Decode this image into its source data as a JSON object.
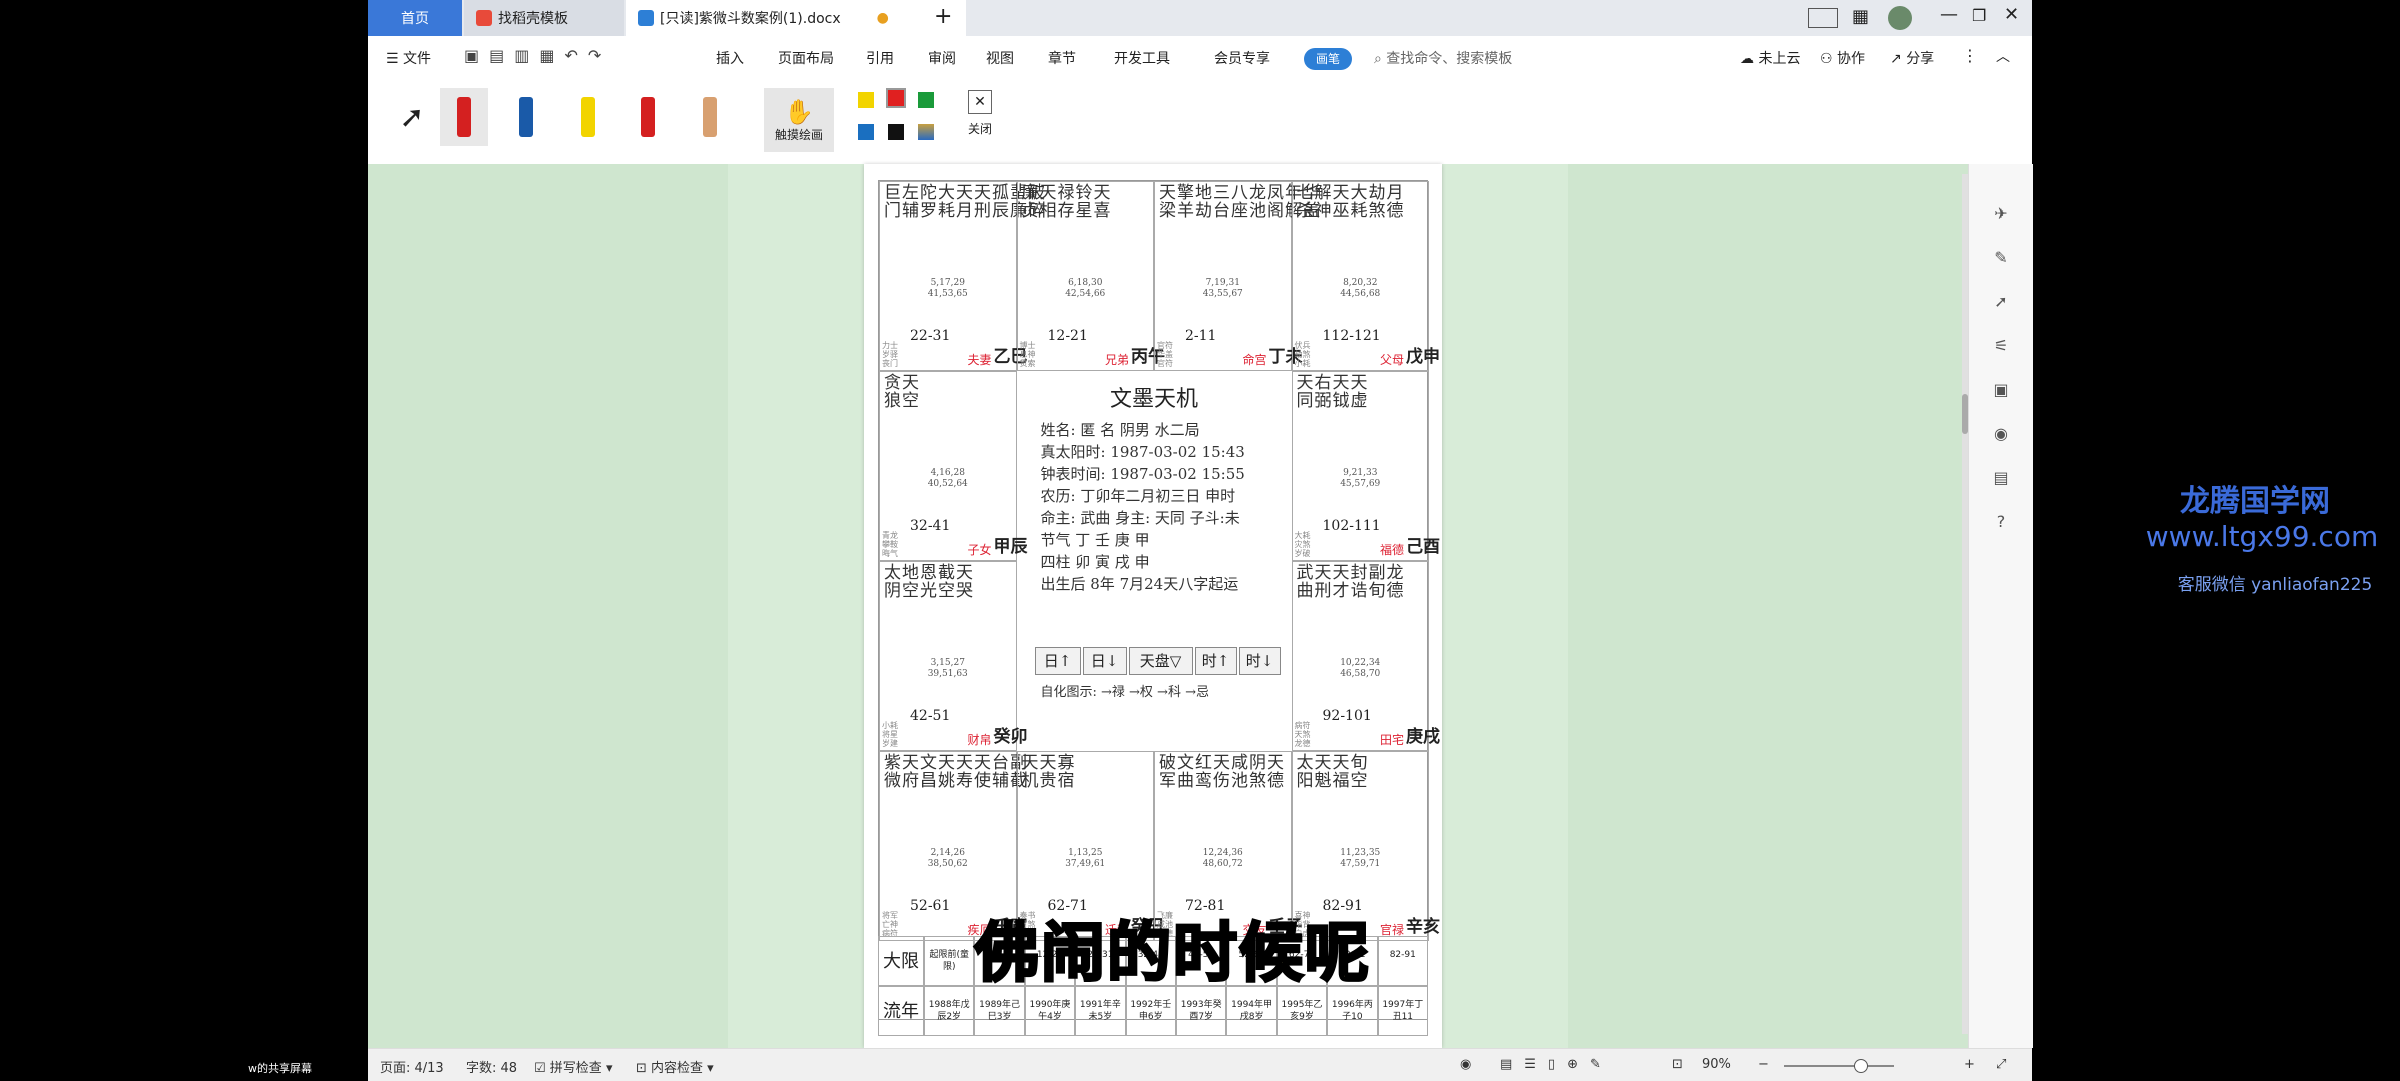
{
  "tabs": {
    "home": "首页",
    "template": "找稻壳模板",
    "doc": "[只读]紫微斗数案例(1).docx"
  },
  "menu": {
    "file": "文件",
    "items": [
      "插入",
      "页面布局",
      "引用",
      "审阅",
      "视图",
      "章节",
      "开发工具",
      "会员专享"
    ],
    "mode": "画笔",
    "search": "查找命令、搜索模板",
    "cloud": "未上云",
    "collab": "协作",
    "share": "分享"
  },
  "toolbar": {
    "touch_draw": "触摸绘画",
    "close": "关闭",
    "swatches": [
      "#f2d400",
      "#e02020",
      "#1a9a3a",
      "#1a6fc0",
      "#111111",
      "#c8a040"
    ]
  },
  "cells": [
    {
      "stars": "巨左陀大天天孤蜚破\n门辅罗耗月刑辰廉碎",
      "cyc": "5,17,29\n41,53,65",
      "rng": "22-31",
      "gz": "乙巳",
      "pal": "夫妻",
      "small": "力士\n岁驿\n丧门"
    },
    {
      "stars": "廉天禄铃天\n贞相存星喜",
      "cyc": "6,18,30\n42,54,66",
      "rng": "12-21",
      "gz": "丙午",
      "pal": "兄弟",
      "small": "博士\n息神\n贯索"
    },
    {
      "stars": "天擎地三八龙凤年华\n梁羊劫台座池阁解盖",
      "cyc": "7,19,31\n43,55,67",
      "rng": "2-11",
      "gz": "丁未",
      "pal": "命宫",
      "small": "官符\n华盖\n官符"
    },
    {
      "stars": "七解天大劫月\n杀神巫耗煞德",
      "cyc": "8,20,32\n44,56,68",
      "rng": "112-121",
      "gz": "戊申",
      "pal": "父母",
      "small": "伏兵\n劫煞\n小耗"
    },
    {
      "stars": "贪天\n狼空",
      "cyc": "4,16,28\n40,52,64",
      "rng": "32-41",
      "gz": "甲辰",
      "pal": "子女",
      "small": "青龙\n攀鞍\n晦气"
    },
    {
      "stars": "天右天天\n同弼钺虚",
      "cyc": "9,21,33\n45,57,69",
      "rng": "102-111",
      "gz": "己酉",
      "pal": "福德",
      "small": "大耗\n灾煞\n岁破"
    },
    {
      "stars": "太地恩截天\n阴空光空哭",
      "cyc": "3,15,27\n39,51,63",
      "rng": "42-51",
      "gz": "癸卯",
      "pal": "财帛",
      "small": "小耗\n将星\n岁建"
    },
    {
      "stars": "武天天封副龙\n曲刑才诰旬德",
      "cyc": "10,22,34\n46,58,70",
      "rng": "92-101",
      "gz": "庚戌",
      "pal": "田宅",
      "small": "病符\n天煞\n龙德"
    },
    {
      "stars": "紫天文天天天台副\n微府昌姚寿使辅截",
      "cyc": "2,14,26\n38,50,62",
      "rng": "52-61",
      "gz": "壬寅",
      "pal": "疾厄",
      "small": "将军\n亡神\n病符"
    },
    {
      "stars": "天天寡\n机贵宿",
      "cyc": "1,13,25\n37,49,61",
      "rng": "62-71",
      "gz": "癸丑",
      "pal": "迁移",
      "small": "奏书\n月煞\n吊客"
    },
    {
      "stars": "破文红天咸阴天\n军曲鸾伤池煞德",
      "cyc": "12,24,36\n48,60,72",
      "rng": "72-81",
      "gz": "壬子",
      "pal": "交友",
      "small": "飞廉\n咸池\n天德"
    },
    {
      "stars": "太天天旬\n阳魁福空",
      "cyc": "11,23,35\n47,59,71",
      "rng": "82-91",
      "gz": "辛亥",
      "pal": "官禄",
      "small": "喜神\n指背\n白虎"
    }
  ],
  "center": {
    "title": "文墨天机",
    "lines": [
      "姓名: 匿 名   阴男 水二局",
      "真太阳时: 1987-03-02 15:43",
      "钟表时间: 1987-03-02 15:55",
      "农历: 丁卯年二月初三日 申时",
      "命主: 武曲 身主: 天同 子斗:未",
      "节气  丁    壬    庚    甲",
      "四柱  卯    寅    戌    申",
      "出生后 8年 7月24天八字起运"
    ],
    "buttons": [
      "日↑",
      "日↓",
      "天盘▽",
      "时↑",
      "时↓"
    ],
    "footer": "自化图示: →禄 →权 →科 →忌"
  },
  "dxtable": {
    "row1_label": "大限",
    "row2_label": "流年",
    "row1": [
      "起限前(童限)",
      "2-11",
      "12-21",
      "22-31",
      "32-41",
      "42-51",
      "52-61",
      "62-71",
      "72-81",
      "82-91"
    ],
    "row2": [
      "1988年戊辰2岁",
      "1989年己巳3岁",
      "1990年庚午4岁",
      "1991年辛未5岁",
      "1992年壬申6岁",
      "1993年癸酉7岁",
      "1994年甲戌8岁",
      "1995年乙亥9岁",
      "1996年丙子10",
      "1997年丁丑11"
    ]
  },
  "status": {
    "page": "页面: 4/13",
    "words": "字数: 48",
    "spell": "拼写检查",
    "content": "内容检查",
    "zoom": "90%"
  },
  "subtitle": "佛闹的时候呢",
  "watermark": {
    "line1": "龙腾国学网",
    "line2": "www.ltgx99.com",
    "line3": "客服微信 yanliaofan225"
  },
  "share_label": "w的共享屏幕"
}
